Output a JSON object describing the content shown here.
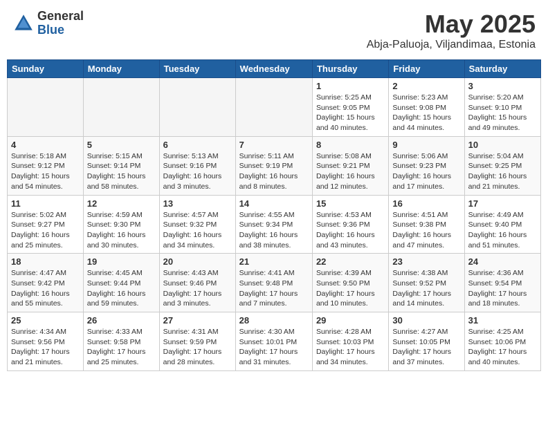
{
  "header": {
    "logo_general": "General",
    "logo_blue": "Blue",
    "month_title": "May 2025",
    "location": "Abja-Paluoja, Viljandimaa, Estonia"
  },
  "days_of_week": [
    "Sunday",
    "Monday",
    "Tuesday",
    "Wednesday",
    "Thursday",
    "Friday",
    "Saturday"
  ],
  "weeks": [
    [
      {
        "day": "",
        "info": ""
      },
      {
        "day": "",
        "info": ""
      },
      {
        "day": "",
        "info": ""
      },
      {
        "day": "",
        "info": ""
      },
      {
        "day": "1",
        "info": "Sunrise: 5:25 AM\nSunset: 9:05 PM\nDaylight: 15 hours\nand 40 minutes."
      },
      {
        "day": "2",
        "info": "Sunrise: 5:23 AM\nSunset: 9:08 PM\nDaylight: 15 hours\nand 44 minutes."
      },
      {
        "day": "3",
        "info": "Sunrise: 5:20 AM\nSunset: 9:10 PM\nDaylight: 15 hours\nand 49 minutes."
      }
    ],
    [
      {
        "day": "4",
        "info": "Sunrise: 5:18 AM\nSunset: 9:12 PM\nDaylight: 15 hours\nand 54 minutes."
      },
      {
        "day": "5",
        "info": "Sunrise: 5:15 AM\nSunset: 9:14 PM\nDaylight: 15 hours\nand 58 minutes."
      },
      {
        "day": "6",
        "info": "Sunrise: 5:13 AM\nSunset: 9:16 PM\nDaylight: 16 hours\nand 3 minutes."
      },
      {
        "day": "7",
        "info": "Sunrise: 5:11 AM\nSunset: 9:19 PM\nDaylight: 16 hours\nand 8 minutes."
      },
      {
        "day": "8",
        "info": "Sunrise: 5:08 AM\nSunset: 9:21 PM\nDaylight: 16 hours\nand 12 minutes."
      },
      {
        "day": "9",
        "info": "Sunrise: 5:06 AM\nSunset: 9:23 PM\nDaylight: 16 hours\nand 17 minutes."
      },
      {
        "day": "10",
        "info": "Sunrise: 5:04 AM\nSunset: 9:25 PM\nDaylight: 16 hours\nand 21 minutes."
      }
    ],
    [
      {
        "day": "11",
        "info": "Sunrise: 5:02 AM\nSunset: 9:27 PM\nDaylight: 16 hours\nand 25 minutes."
      },
      {
        "day": "12",
        "info": "Sunrise: 4:59 AM\nSunset: 9:30 PM\nDaylight: 16 hours\nand 30 minutes."
      },
      {
        "day": "13",
        "info": "Sunrise: 4:57 AM\nSunset: 9:32 PM\nDaylight: 16 hours\nand 34 minutes."
      },
      {
        "day": "14",
        "info": "Sunrise: 4:55 AM\nSunset: 9:34 PM\nDaylight: 16 hours\nand 38 minutes."
      },
      {
        "day": "15",
        "info": "Sunrise: 4:53 AM\nSunset: 9:36 PM\nDaylight: 16 hours\nand 43 minutes."
      },
      {
        "day": "16",
        "info": "Sunrise: 4:51 AM\nSunset: 9:38 PM\nDaylight: 16 hours\nand 47 minutes."
      },
      {
        "day": "17",
        "info": "Sunrise: 4:49 AM\nSunset: 9:40 PM\nDaylight: 16 hours\nand 51 minutes."
      }
    ],
    [
      {
        "day": "18",
        "info": "Sunrise: 4:47 AM\nSunset: 9:42 PM\nDaylight: 16 hours\nand 55 minutes."
      },
      {
        "day": "19",
        "info": "Sunrise: 4:45 AM\nSunset: 9:44 PM\nDaylight: 16 hours\nand 59 minutes."
      },
      {
        "day": "20",
        "info": "Sunrise: 4:43 AM\nSunset: 9:46 PM\nDaylight: 17 hours\nand 3 minutes."
      },
      {
        "day": "21",
        "info": "Sunrise: 4:41 AM\nSunset: 9:48 PM\nDaylight: 17 hours\nand 7 minutes."
      },
      {
        "day": "22",
        "info": "Sunrise: 4:39 AM\nSunset: 9:50 PM\nDaylight: 17 hours\nand 10 minutes."
      },
      {
        "day": "23",
        "info": "Sunrise: 4:38 AM\nSunset: 9:52 PM\nDaylight: 17 hours\nand 14 minutes."
      },
      {
        "day": "24",
        "info": "Sunrise: 4:36 AM\nSunset: 9:54 PM\nDaylight: 17 hours\nand 18 minutes."
      }
    ],
    [
      {
        "day": "25",
        "info": "Sunrise: 4:34 AM\nSunset: 9:56 PM\nDaylight: 17 hours\nand 21 minutes."
      },
      {
        "day": "26",
        "info": "Sunrise: 4:33 AM\nSunset: 9:58 PM\nDaylight: 17 hours\nand 25 minutes."
      },
      {
        "day": "27",
        "info": "Sunrise: 4:31 AM\nSunset: 9:59 PM\nDaylight: 17 hours\nand 28 minutes."
      },
      {
        "day": "28",
        "info": "Sunrise: 4:30 AM\nSunset: 10:01 PM\nDaylight: 17 hours\nand 31 minutes."
      },
      {
        "day": "29",
        "info": "Sunrise: 4:28 AM\nSunset: 10:03 PM\nDaylight: 17 hours\nand 34 minutes."
      },
      {
        "day": "30",
        "info": "Sunrise: 4:27 AM\nSunset: 10:05 PM\nDaylight: 17 hours\nand 37 minutes."
      },
      {
        "day": "31",
        "info": "Sunrise: 4:25 AM\nSunset: 10:06 PM\nDaylight: 17 hours\nand 40 minutes."
      }
    ]
  ]
}
